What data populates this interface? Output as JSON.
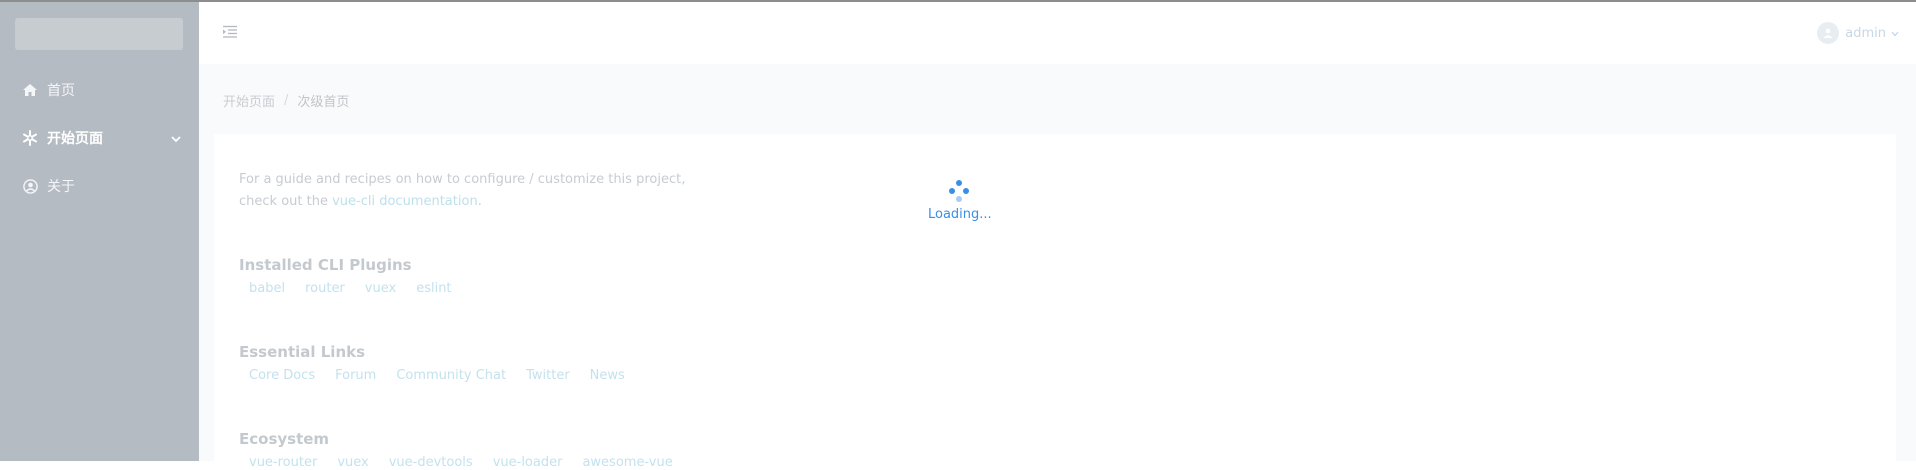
{
  "sidebar": {
    "items": [
      {
        "label": "首页",
        "icon": "home-icon"
      },
      {
        "label": "开始页面",
        "icon": "snowflake-icon",
        "expanded": true
      },
      {
        "label": "关于",
        "icon": "user-circle-icon"
      }
    ]
  },
  "header": {
    "user": "admin"
  },
  "breadcrumb": {
    "items": [
      "开始页面",
      "次级首页"
    ],
    "separator": "/"
  },
  "content": {
    "intro_line1": "For a guide and recipes on how to configure / customize this project,",
    "intro_line2_prefix": "check out the ",
    "intro_link": "vue-cli documentation",
    "intro_line2_suffix": ".",
    "sections": [
      {
        "title": "Installed CLI Plugins",
        "links": [
          "babel",
          "router",
          "vuex",
          "eslint"
        ]
      },
      {
        "title": "Essential Links",
        "links": [
          "Core Docs",
          "Forum",
          "Community Chat",
          "Twitter",
          "News"
        ]
      },
      {
        "title": "Ecosystem",
        "links": [
          "vue-router",
          "vuex",
          "vue-devtools",
          "vue-loader",
          "awesome-vue"
        ]
      }
    ]
  },
  "loading": {
    "text": "Loading..."
  },
  "colors": {
    "sidebar_bg": "#b5bbc2",
    "accent": "#3a8ee6",
    "link": "#c3e2ee"
  }
}
